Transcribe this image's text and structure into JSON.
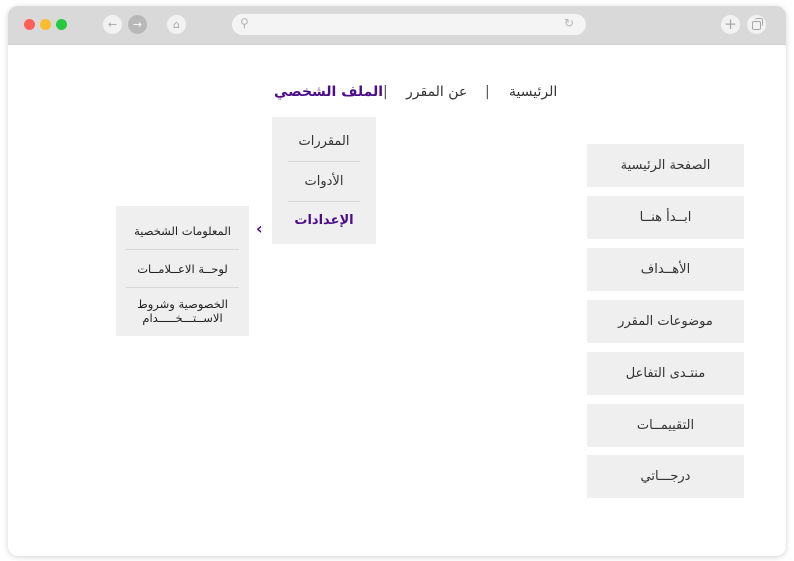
{
  "browser": {
    "icons": {
      "back": "arrow-left-icon",
      "forward": "arrow-right-icon",
      "home": "home-icon",
      "search": "search-icon",
      "reload": "reload-icon",
      "new_tab": "plus-icon",
      "tabs": "tabs-icon"
    },
    "url": ""
  },
  "topnav": {
    "items": [
      "الرئيسية",
      "عن المقرر",
      "الملف الشخصي"
    ],
    "separator": "|",
    "active_index": 2
  },
  "dropdown": {
    "items": [
      "المقررات",
      "الأدوات",
      "الإعدادات"
    ],
    "active_index": 2
  },
  "submenu": {
    "chevron": "‹",
    "items": [
      "المعلومات الشخصية",
      "لوحــة الاعــلامــات",
      "الخصوصية وشروط الاســتـــخـــــدام"
    ]
  },
  "sidebar": {
    "items": [
      "الصفحة الرئيسية",
      "ابــدأ هنــا",
      "الأهــداف",
      "موضوعات المقرر",
      "منتـدى التفاعل",
      "التقييمــات",
      "درجـــاتي"
    ]
  },
  "colors": {
    "accent": "#4b0d8a",
    "panel": "#efefef",
    "titlebar": "#d9d9d9"
  }
}
